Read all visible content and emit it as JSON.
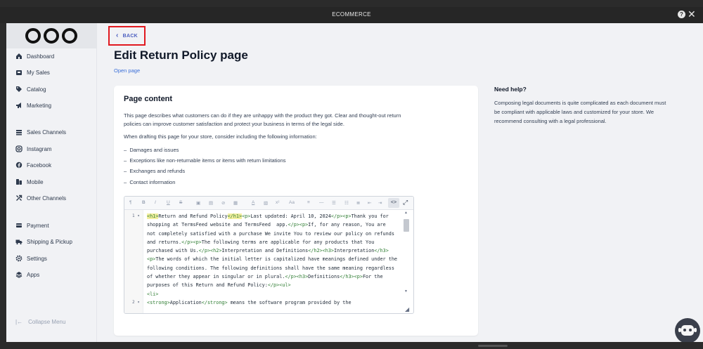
{
  "window": {
    "title": "ECOMMERCE",
    "help_label": "?",
    "close_label": "✕"
  },
  "sidebar": {
    "items": [
      {
        "label": "Dashboard",
        "icon": "home-icon"
      },
      {
        "label": "My Sales",
        "icon": "inbox-icon"
      },
      {
        "label": "Catalog",
        "icon": "tag-icon"
      },
      {
        "label": "Marketing",
        "icon": "megaphone-icon"
      },
      {
        "label": "Sales Channels",
        "icon": "layers-icon"
      },
      {
        "label": "Instagram",
        "icon": "instagram-icon"
      },
      {
        "label": "Facebook",
        "icon": "facebook-icon"
      },
      {
        "label": "Mobile",
        "icon": "mobile-icon"
      },
      {
        "label": "Other Channels",
        "icon": "share-icon"
      },
      {
        "label": "Payment",
        "icon": "card-icon"
      },
      {
        "label": "Shipping & Pickup",
        "icon": "truck-icon"
      },
      {
        "label": "Settings",
        "icon": "gear-icon"
      },
      {
        "label": "Apps",
        "icon": "stack-icon"
      }
    ],
    "collapse_label": "Collapse Menu"
  },
  "main": {
    "back_label": "BACK",
    "title": "Edit Return Policy page",
    "open_page_label": "Open page",
    "card": {
      "heading": "Page content",
      "intro": "This page describes what customers can do if they are unhappy with the product they got. Clear and thought-out return policies can improve customer satisfaction and protect your business in terms of the legal side.",
      "consider": "When drafting this page for your store, consider including the following information:",
      "bullets": [
        "Damages and issues",
        "Exceptions like non-returnable items or items with return limitations",
        "Exchanges and refunds",
        "Contact information"
      ]
    },
    "editor": {
      "toolbar": [
        "¶",
        "B",
        "I",
        "U",
        "S",
        "▣",
        "▤",
        "⊘",
        "▦",
        "A",
        "▧",
        "x²",
        "Aa",
        "≡",
        "—",
        "☰",
        "☷",
        "≣",
        "⇤",
        "⇥"
      ],
      "source_label": "<>",
      "line_numbers": [
        "1",
        "2"
      ],
      "code": "<h1>Return and Refund Policy</h1><p>Last updated: April 10, 2024</p><p>Thank you for shopping at TermsFeed website and TermsFeed  app.</p><p>If, for any reason, You are not completely satisfied with a purchase We invite You to review our policy on refunds and returns.</p><p>The following terms are applicable for any products that You purchased with Us.</p><h2>Interpretation and Definitions</h2><h3>Interpretation</h3><p>The words of which the initial letter is capitalized have meanings defined under the following conditions. The following definitions shall have the same meaning regardless of whether they appear in singular or in plural.</p><h3>Definitions</h3><p>For the purposes of this Return and Refund Policy:</p><ul>\n<li>\n<strong>Application</strong> means the software program provided by the"
    }
  },
  "help": {
    "title": "Need help?",
    "text": "Composing legal documents is quite complicated as each document must be compliant with applicable laws and customized for your store. We recommend consulting with a legal professional."
  },
  "colors": {
    "back_border": "#e1191f",
    "link": "#3b6fd8",
    "code_tag": "#2e7d32",
    "tag_highlight": "#f3ef9e"
  }
}
